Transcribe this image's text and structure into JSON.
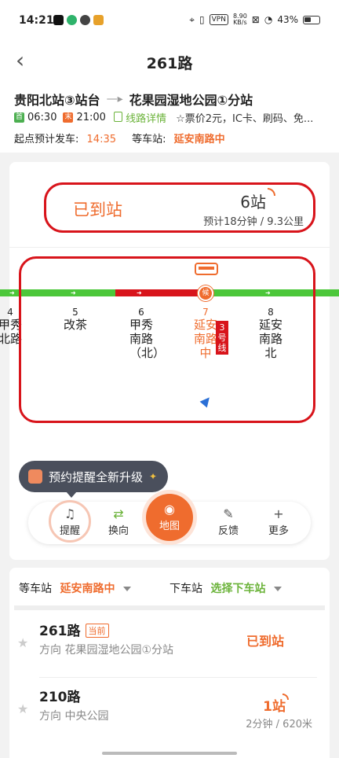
{
  "status_bar": {
    "time": "14:21",
    "vpn": "VPN",
    "speed_value": "8.90",
    "speed_unit": "KB/s",
    "battery": "43%"
  },
  "header": {
    "title": "261路",
    "back_icon": "‹"
  },
  "route": {
    "from": "贵阳北站③站台",
    "arrow": "—▸",
    "to": "花果园湿地公园①分站",
    "first_tag": "首",
    "first_time": "06:30",
    "last_tag": "末",
    "last_time": "21:00",
    "detail_link": "线路详情",
    "fare": "☆票价2元，IC卡、刷码、免...",
    "start_label": "起点预计发车:",
    "start_time": "14:35",
    "wait_label": "等车站:",
    "wait_station": "延安南路中"
  },
  "arrival": {
    "status": "已到站",
    "stops_away": "6站",
    "eta": "预计18分钟 / 9.3公里"
  },
  "stops": [
    {
      "num": "4",
      "name": "甲秀北路"
    },
    {
      "num": "5",
      "name": "改茶"
    },
    {
      "num": "6",
      "name": "甲秀南路（北）"
    },
    {
      "num": "7",
      "name": "延安南路中"
    },
    {
      "num": "8",
      "name": "延安南路北"
    }
  ],
  "current_stop_badge": "3号线",
  "stop_marker": "候",
  "tooltip": {
    "text": "预约提醒全新升级"
  },
  "toolbar": {
    "remind": "提醒",
    "switch": "换向",
    "map": "地图",
    "feedback": "反馈",
    "more": "更多"
  },
  "selector": {
    "wait_label": "等车站",
    "wait_value": "延安南路中",
    "alight_label": "下车站",
    "alight_value": "选择下车站"
  },
  "bus_list": [
    {
      "name": "261路",
      "badge": "当前",
      "direction": "方向 花果园湿地公园①分站",
      "status": "已到站"
    },
    {
      "name": "210路",
      "direction": "方向 中央公园",
      "stops": "1站",
      "eta": "2分钟 / 620米"
    }
  ],
  "colors": {
    "accent": "#ef6c2e",
    "green": "#6bb33a",
    "annotation_red": "#d8141b"
  }
}
